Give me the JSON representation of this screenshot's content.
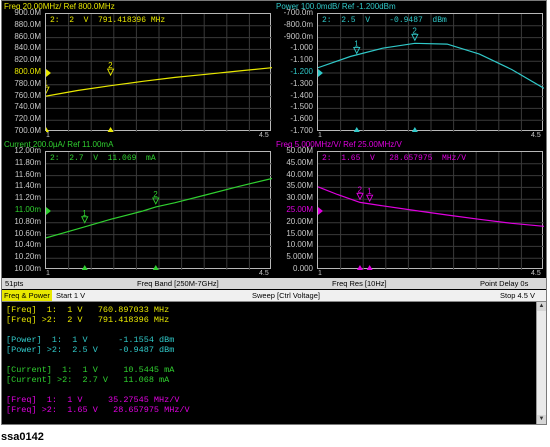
{
  "panes": [
    {
      "id": "freq",
      "color": "#e8e800",
      "title": "Freq 20.00MHz/ Ref 800.0MHz",
      "marker_text": "2:  2  V  791.418396 MHz",
      "y_ticks": [
        "900.0M",
        "880.0M",
        "860.0M",
        "840.0M",
        "820.0M",
        "800.0M",
        "780.0M",
        "760.0M",
        "740.0M",
        "720.0M",
        "700.0M"
      ],
      "ref_index": 5,
      "x_start": "1",
      "x_stop": "4.5",
      "curve": [
        [
          1,
          760.9
        ],
        [
          1.5,
          770.5
        ],
        [
          2,
          778.5
        ],
        [
          2.5,
          786
        ],
        [
          3,
          792.5
        ],
        [
          3.5,
          798
        ],
        [
          4,
          803.5
        ],
        [
          4.5,
          809
        ]
      ],
      "y_top": 900,
      "y_bottom": 700,
      "markers": [
        {
          "label": "1",
          "x": 1,
          "y": 760.9
        },
        {
          "label": "2",
          "x": 2,
          "y": 791.4
        }
      ]
    },
    {
      "id": "power",
      "color": "#30c8c8",
      "title": "Power 100.0mdB/ Ref -1.200dBm",
      "marker_text": "2:  2.5  V    -0.9487  dBm",
      "y_ticks": [
        "-700.0m",
        "-800.0m",
        "-900.0m",
        "-1.000",
        "-1.100",
        "-1.200",
        "-1.300",
        "-1.400",
        "-1.500",
        "-1.600",
        "-1.700"
      ],
      "ref_index": 5,
      "x_start": "1",
      "x_stop": "4.5",
      "curve": [
        [
          1,
          -1.1554
        ],
        [
          1.5,
          -1.06
        ],
        [
          2,
          -0.99
        ],
        [
          2.5,
          -0.9487
        ],
        [
          3,
          -0.955
        ],
        [
          3.5,
          -1.04
        ],
        [
          4,
          -1.17
        ],
        [
          4.5,
          -1.33
        ]
      ],
      "y_top": -0.7,
      "y_bottom": -1.7,
      "markers": [
        {
          "label": "1",
          "x": 1.6,
          "y": -1.06
        },
        {
          "label": "2",
          "x": 2.5,
          "y": -0.9487
        }
      ]
    },
    {
      "id": "current",
      "color": "#30d030",
      "title": "Current 200.0µA/ Ref 11.00mA",
      "marker_text": "2:  2.7  V  11.069  mA",
      "y_ticks": [
        "12.00m",
        "11.80m",
        "11.60m",
        "11.40m",
        "11.20m",
        "11.00m",
        "10.80m",
        "10.60m",
        "10.40m",
        "10.20m",
        "10.00m"
      ],
      "ref_index": 5,
      "x_start": "1",
      "x_stop": "4.5",
      "curve": [
        [
          1,
          10.5445
        ],
        [
          1.5,
          10.7
        ],
        [
          2,
          10.86
        ],
        [
          2.5,
          11.0
        ],
        [
          2.7,
          11.069
        ],
        [
          3,
          11.14
        ],
        [
          3.5,
          11.28
        ],
        [
          4,
          11.42
        ],
        [
          4.5,
          11.55
        ]
      ],
      "y_top": 12,
      "y_bottom": 10,
      "markers": [
        {
          "label": "1",
          "x": 1.6,
          "y": 10.75
        },
        {
          "label": "2",
          "x": 2.7,
          "y": 11.069
        }
      ]
    },
    {
      "id": "freqres",
      "color": "#e000e0",
      "title": "Freq 5.000MHz/V/ Ref 25.00MHz/V",
      "marker_text": "2:  1.65  V   28.657975  MHz/V",
      "y_ticks": [
        "50.00M",
        "45.00M",
        "40.00M",
        "35.00M",
        "30.00M",
        "25.00M",
        "20.00M",
        "15.00M",
        "10.00M",
        "5.000M",
        "0.000"
      ],
      "ref_index": 5,
      "x_start": "1",
      "x_stop": "4.5",
      "curve": [
        [
          1,
          35.27
        ],
        [
          1.3,
          32.0
        ],
        [
          1.65,
          28.66
        ],
        [
          2,
          27.2
        ],
        [
          2.5,
          25.2
        ],
        [
          3,
          23.3
        ],
        [
          3.5,
          21.5
        ],
        [
          4,
          19.8
        ],
        [
          4.5,
          18.5
        ]
      ],
      "y_top": 50,
      "y_bottom": 0,
      "markers": [
        {
          "label": "1",
          "x": 1.8,
          "y": 27.9
        },
        {
          "label": "2",
          "x": 1.65,
          "y": 28.66
        }
      ]
    }
  ],
  "status": {
    "points": "51pts",
    "freq_band": "Freq Band [250M-7GHz]",
    "freq_res": "Freq Res [10Hz]",
    "point_delay": "Point Delay 0s"
  },
  "control": {
    "tab": "Freq & Power",
    "start": "Start 1 V",
    "sweep": "Sweep [Ctrl Voltage]",
    "stop": "Stop 4.5 V"
  },
  "readout": [
    {
      "color": "#e8e800",
      "text": "[Freq]  1:  1 V   760.897033 MHz"
    },
    {
      "color": "#e8e800",
      "text": "[Freq] >2:  2 V   791.418396 MHz"
    },
    {
      "color": "",
      "text": ""
    },
    {
      "color": "#30c8c8",
      "text": "[Power]  1:  1 V      -1.1554 dBm"
    },
    {
      "color": "#30c8c8",
      "text": "[Power] >2:  2.5 V    -0.9487 dBm"
    },
    {
      "color": "",
      "text": ""
    },
    {
      "color": "#30d030",
      "text": "[Current]  1:  1 V     10.5445 mA"
    },
    {
      "color": "#30d030",
      "text": "[Current] >2:  2.7 V   11.068 mA"
    },
    {
      "color": "",
      "text": ""
    },
    {
      "color": "#e000e0",
      "text": "[Freq]  1:  1 V     35.27545 MHz/V"
    },
    {
      "color": "#e000e0",
      "text": "[Freq] >2:  1.65 V   28.657975 MHz/V"
    }
  ],
  "caption": "ssa0142",
  "scroll": {
    "up": "▲",
    "down": "▼"
  }
}
